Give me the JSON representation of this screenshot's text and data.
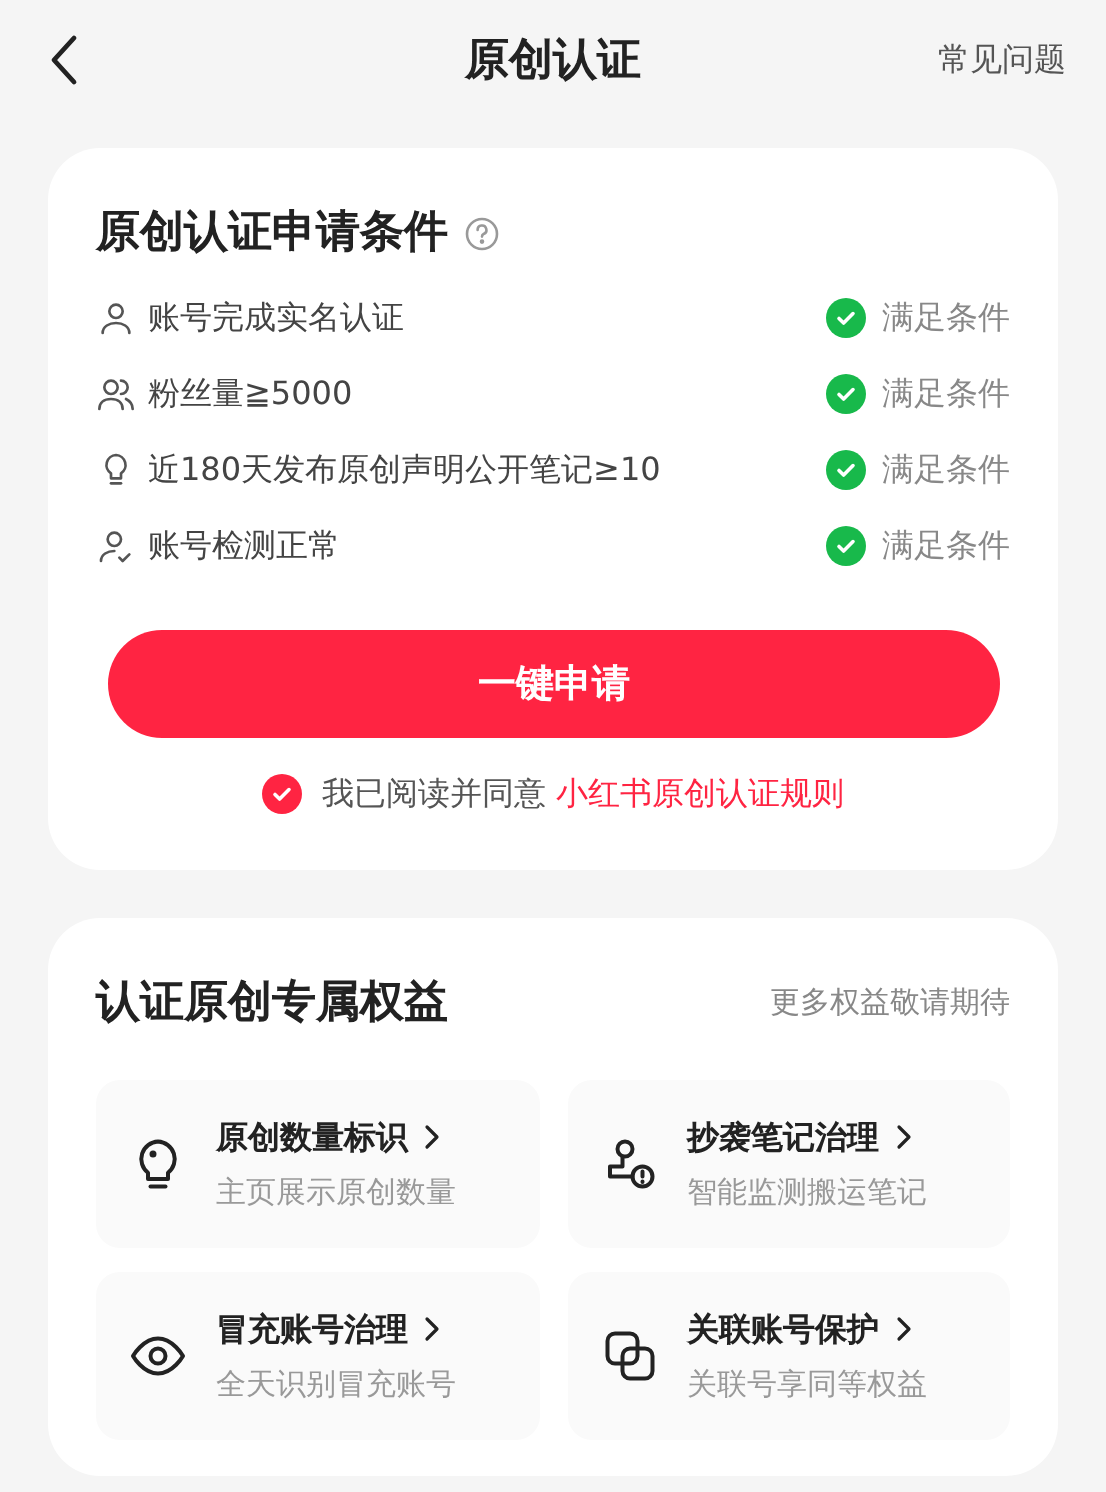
{
  "header": {
    "title": "原创认证",
    "help_link": "常见问题"
  },
  "conditions_card": {
    "title": "原创认证申请条件",
    "conditions": [
      {
        "kind": "user",
        "label": "账号完成实名认证",
        "met": true,
        "status": "满足条件"
      },
      {
        "kind": "users",
        "label": "粉丝量≧5000",
        "met": true,
        "status": "满足条件"
      },
      {
        "kind": "bulb",
        "label": "近180天发布原创声明公开笔记≥10",
        "met": true,
        "status": "满足条件"
      },
      {
        "kind": "user-check",
        "label": "账号检测正常",
        "met": true,
        "status": "满足条件"
      }
    ],
    "apply_button": "一键申请",
    "agreement": {
      "checked": true,
      "text": "我已阅读并同意",
      "link": "小红书原创认证规则"
    }
  },
  "benefits_card": {
    "title": "认证原创专属权益",
    "note": "更多权益敬请期待",
    "benefits": [
      {
        "kind": "bulb",
        "title": "原创数量标识",
        "subtitle": "主页展示原创数量"
      },
      {
        "kind": "stamp",
        "title": "抄袭笔记治理",
        "subtitle": "智能监测搬运笔记"
      },
      {
        "kind": "eye",
        "title": "冒充账号治理",
        "subtitle": "全天识别冒充账号"
      },
      {
        "kind": "link",
        "title": "关联账号保护",
        "subtitle": "关联号享同等权益"
      }
    ]
  }
}
